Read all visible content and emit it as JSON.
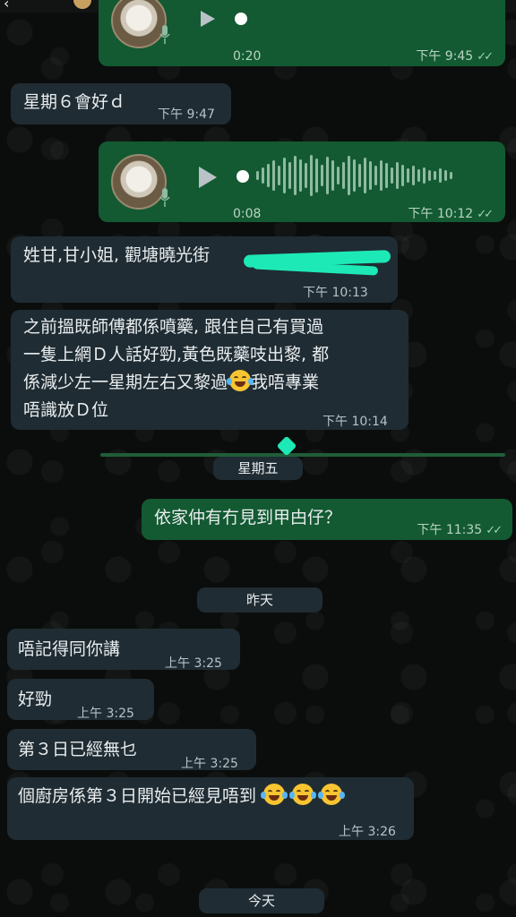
{
  "chat": {
    "messages": {
      "m1": {
        "duration": "0:20",
        "time": "下午 9:45"
      },
      "m2": {
        "text": "星期６會好ｄ",
        "time": "下午 9:47"
      },
      "m3": {
        "duration": "0:08",
        "time": "下午 10:12"
      },
      "m4": {
        "text": "姓甘,甘小姐, 觀塘曉光街",
        "time": "下午 10:13"
      },
      "m5": {
        "line1": "之前搵既師傅都係噴藥, 跟住自己有買過",
        "line2": "一隻上網Ｄ人話好勁,黃色既藥吱出黎, 都",
        "line3": "係減少左一星期左右又黎過",
        "line3b": "我唔專業",
        "line4": "唔識放Ｄ位",
        "time": "下午 10:14"
      },
      "m6": {
        "text": "依家仲有冇見到甲甴仔？",
        "time": "下午 11:35"
      },
      "m7": {
        "text": "唔記得同你講",
        "time": "上午 3:25"
      },
      "m8": {
        "text": "好勁",
        "time": "上午 3:25"
      },
      "m9": {
        "text": "第３日已經無乜",
        "time": "上午 3:25"
      },
      "m10": {
        "text": "個廚房係第３日開始已經見唔到",
        "time": "上午 3:26"
      }
    },
    "dates": {
      "friday": "星期五",
      "yesterday": "昨天",
      "today": "今天"
    }
  },
  "colors": {
    "incoming_bubble": "#1f2c33",
    "outgoing_bubble": "#135a32",
    "highlight_scribble": "#1de9b6"
  },
  "icons": [
    "back-icon",
    "avatar",
    "video-call-icon",
    "phone-icon",
    "play-icon",
    "microphone-icon",
    "read-ticks-icon",
    "tears-of-joy-emoji"
  ]
}
